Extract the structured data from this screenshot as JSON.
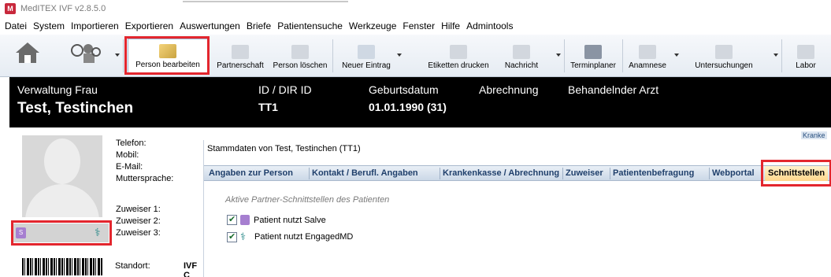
{
  "window": {
    "title": "MedITEX IVF v2.8.5.0",
    "icon_color": "#c8283c"
  },
  "menu": [
    {
      "label": "Datei"
    },
    {
      "label": "System"
    },
    {
      "label": "Importieren"
    },
    {
      "label": "Exportieren"
    },
    {
      "label": "Auswertungen"
    },
    {
      "label": "Briefe"
    },
    {
      "label": "Patientensuche"
    },
    {
      "label": "Werkzeuge"
    },
    {
      "label": "Fenster"
    },
    {
      "label": "Hilfe"
    },
    {
      "label": "Admintools"
    }
  ],
  "toolbar": {
    "person_bearbeiten": "Person bearbeiten",
    "partnerschaft": "Partnerschaft",
    "person_loeschen": "Person löschen",
    "neuer_eintrag": "Neuer Eintrag",
    "etiketten_drucken": "Etiketten drucken",
    "nachricht": "Nachricht",
    "terminplaner": "Terminplaner",
    "anamnese": "Anamnese",
    "untersuchungen": "Untersuchungen",
    "labor": "Labor"
  },
  "patient": {
    "section_label": "Verwaltung Frau",
    "name": "Test, Testinchen",
    "id_label": "ID / DIR ID",
    "id_value": "TT1",
    "dob_label": "Geburtsdatum",
    "dob_value": "01.01.1990  (31)",
    "billing_label": "Abrechnung",
    "doctor_label": "Behandelnder Arzt"
  },
  "left_panel": {
    "telefon": "Telefon:",
    "mobil": "Mobil:",
    "email": "E-Mail:",
    "muttersprache": "Muttersprache:",
    "zuweiser1": "Zuweiser 1:",
    "zuweiser2": "Zuweiser 2:",
    "zuweiser3": "Zuweiser 3:",
    "standort_label": "Standort:",
    "standort_value": "IVF C"
  },
  "dialog": {
    "title": "Stammdaten von Test, Testinchen (TT1)",
    "kranke_tab": "Kranke",
    "tabs": [
      {
        "label": "Angaben zur Person"
      },
      {
        "label": "Kontakt / Berufl. Angaben"
      },
      {
        "label": "Krankenkasse / Abrechnung"
      },
      {
        "label": "Zuweiser"
      },
      {
        "label": "Patientenbefragung"
      },
      {
        "label": "Webportal"
      },
      {
        "label": "Schnittstellen"
      }
    ],
    "active_tab": "Schnittstellen",
    "section_title": "Aktive Partner-Schnittstellen des Patienten",
    "checks": [
      {
        "label": "Patient nutzt Salve",
        "checked": true,
        "icon": "salve-icon"
      },
      {
        "label": "Patient nutzt EngagedMD",
        "checked": true,
        "icon": "engagedmd-icon"
      }
    ]
  },
  "colors": {
    "highlight": "#e3262e",
    "tab_text": "#1f3f6b",
    "header_bg": "#000000"
  }
}
